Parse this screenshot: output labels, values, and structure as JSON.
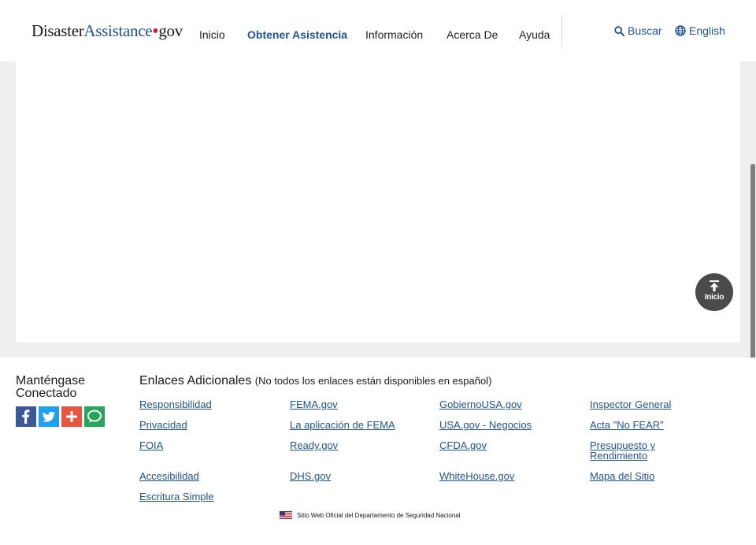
{
  "header": {
    "logo": {
      "part1": "Disaster",
      "part2": "Assistance",
      "dot": "•",
      "part3": "gov"
    },
    "nav": [
      {
        "label": "Inicio",
        "active": false
      },
      {
        "label": "Obtener Asistencia",
        "active": true
      },
      {
        "label": "Información",
        "active": false
      },
      {
        "label": "Acerca De",
        "active": false
      },
      {
        "label": "Ayuda",
        "active": false
      }
    ],
    "search_label": "Buscar",
    "language_label": "English"
  },
  "back_to_top": {
    "label": "Inicio",
    "icon": "arrow-up-to-line-icon"
  },
  "footer": {
    "stay_connected": "Manténgase Conectado",
    "social_icons": [
      "facebook-icon",
      "twitter-icon",
      "add-share-icon",
      "chat-icon"
    ],
    "links_title": "Enlaces Adicionales",
    "links_note": "(No todos los enlaces están disponibles en español)",
    "columns": [
      [
        "Responsibilidad",
        "Privacidad",
        "FOIA",
        "Accesibilidad",
        "Escritura Simple"
      ],
      [
        "FEMA.gov",
        "La aplicación de FEMA",
        "Ready.gov",
        "DHS.gov"
      ],
      [
        "GobiernoUSA.gov",
        "USA.gov - Negocios",
        "CFDA.gov",
        "WhiteHouse.gov"
      ],
      [
        "Inspector General",
        "Acta \"No FEAR\"",
        "Presupuesto y Rendimiento",
        "Mapa del Sitio"
      ]
    ],
    "official_site": "Sitio Web Oficial del Departamento de Seguridad Nacional"
  },
  "colors": {
    "brand_blue": "#205493",
    "brand_red": "#c41e3a",
    "page_gray": "#efefef",
    "facebook": "#3b5998",
    "twitter": "#1da1f2",
    "share": "#e8563f",
    "chat": "#26a65b"
  }
}
